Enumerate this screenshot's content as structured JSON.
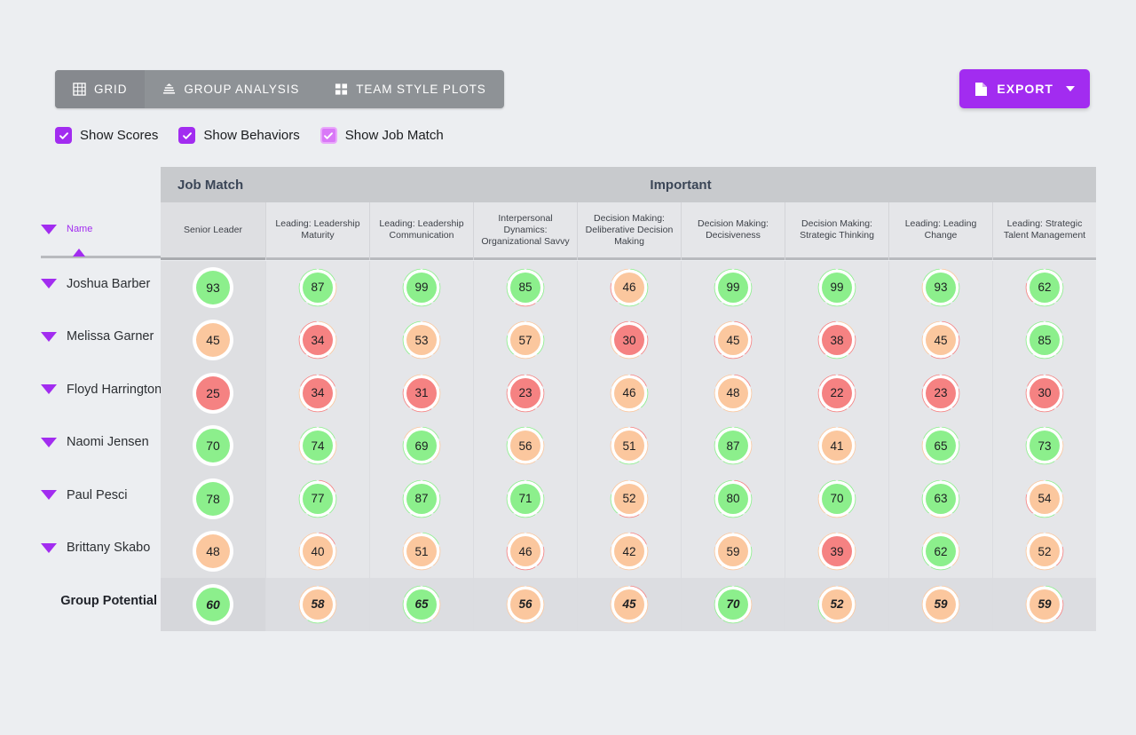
{
  "toolbar": {
    "tabs": [
      {
        "label": "GRID",
        "icon": "grid-icon",
        "active": true
      },
      {
        "label": "GROUP ANALYSIS",
        "icon": "group-analysis-icon",
        "active": false
      },
      {
        "label": "TEAM STYLE PLOTS",
        "icon": "team-style-plots-icon",
        "active": false
      }
    ],
    "export_label": "EXPORT",
    "export_icon": "document-icon",
    "export_color": "#a22cf0"
  },
  "filters": [
    {
      "label": "Show Scores",
      "checked": true,
      "style": "solid"
    },
    {
      "label": "Show Behaviors",
      "checked": true,
      "style": "solid"
    },
    {
      "label": "Show Job Match",
      "checked": true,
      "style": "light"
    }
  ],
  "grid": {
    "name_column": {
      "sort_label": "Name",
      "sort_direction": "ascending"
    },
    "bands": [
      {
        "label": "Job Match",
        "span": 1
      },
      {
        "label": "Important",
        "span": 8
      }
    ],
    "columns": [
      "Senior Leader",
      "Leading: Leadership Maturity",
      "Leading: Leadership Communication",
      "Interpersonal Dynamics: Organizational Savvy",
      "Decision Making: Deliberative Decision Making",
      "Decision Making: Decisiveness",
      "Decision Making: Strategic Thinking",
      "Leading: Leading Change",
      "Leading: Strategic Talent Management"
    ],
    "colors": {
      "green": "#8cef8c",
      "orange": "#fbc79e",
      "red": "#f58282"
    },
    "rows": [
      {
        "name": "Joshua Barber",
        "group": false,
        "cells": [
          {
            "value": 93,
            "color": "green",
            "ring": []
          },
          {
            "value": 87,
            "color": "green",
            "ring": [
              "green",
              "orange",
              "green",
              "green",
              "green"
            ]
          },
          {
            "value": 99,
            "color": "green",
            "ring": [
              "green",
              "green",
              "green",
              "green",
              "green"
            ]
          },
          {
            "value": 85,
            "color": "green",
            "ring": [
              "green",
              "green",
              "red",
              "green",
              "green"
            ]
          },
          {
            "value": 46,
            "color": "orange",
            "ring": [
              "green",
              "green",
              "green",
              "red",
              "orange"
            ]
          },
          {
            "value": 99,
            "color": "green",
            "ring": [
              "green",
              "green",
              "green",
              "green",
              "green"
            ]
          },
          {
            "value": 99,
            "color": "green",
            "ring": [
              "green",
              "green",
              "green",
              "green",
              "green"
            ]
          },
          {
            "value": 93,
            "color": "green",
            "ring": [
              "orange",
              "green",
              "green",
              "orange",
              "green"
            ]
          },
          {
            "value": 62,
            "color": "green",
            "ring": [
              "green",
              "green",
              "green",
              "red",
              "green"
            ]
          }
        ]
      },
      {
        "name": "Melissa Garner",
        "group": false,
        "cells": [
          {
            "value": 45,
            "color": "orange",
            "ring": []
          },
          {
            "value": 34,
            "color": "red",
            "ring": [
              "orange",
              "orange",
              "red",
              "red",
              "red"
            ]
          },
          {
            "value": 53,
            "color": "orange",
            "ring": [
              "orange",
              "orange",
              "orange",
              "green",
              "green"
            ]
          },
          {
            "value": 57,
            "color": "orange",
            "ring": [
              "orange",
              "green",
              "orange",
              "green",
              "orange"
            ]
          },
          {
            "value": 30,
            "color": "red",
            "ring": [
              "red",
              "red",
              "orange",
              "orange",
              "red"
            ]
          },
          {
            "value": 45,
            "color": "orange",
            "ring": [
              "red",
              "red",
              "red",
              "red",
              "orange"
            ]
          },
          {
            "value": 38,
            "color": "red",
            "ring": [
              "orange",
              "red",
              "green",
              "red",
              "red"
            ]
          },
          {
            "value": 45,
            "color": "orange",
            "ring": [
              "red",
              "red",
              "red",
              "orange",
              "orange"
            ]
          },
          {
            "value": 85,
            "color": "green",
            "ring": [
              "green",
              "green",
              "green",
              "green",
              "green"
            ]
          }
        ]
      },
      {
        "name": "Floyd Harrington",
        "group": false,
        "cells": [
          {
            "value": 25,
            "color": "red",
            "ring": []
          },
          {
            "value": 34,
            "color": "red",
            "ring": [
              "red",
              "orange",
              "red",
              "orange",
              "red"
            ]
          },
          {
            "value": 31,
            "color": "red",
            "ring": [
              "orange",
              "orange",
              "red",
              "red",
              "orange"
            ]
          },
          {
            "value": 23,
            "color": "red",
            "ring": [
              "red",
              "red",
              "red",
              "red",
              "red"
            ]
          },
          {
            "value": 46,
            "color": "orange",
            "ring": [
              "red",
              "green",
              "orange",
              "orange",
              "orange"
            ]
          },
          {
            "value": 48,
            "color": "orange",
            "ring": [
              "red",
              "orange",
              "orange",
              "orange",
              "orange"
            ]
          },
          {
            "value": 22,
            "color": "red",
            "ring": [
              "red",
              "red",
              "red",
              "red",
              "red"
            ]
          },
          {
            "value": 23,
            "color": "red",
            "ring": [
              "red",
              "red",
              "red",
              "red",
              "red"
            ]
          },
          {
            "value": 30,
            "color": "red",
            "ring": [
              "red",
              "red",
              "red",
              "red",
              "red"
            ]
          }
        ]
      },
      {
        "name": "Naomi Jensen",
        "group": false,
        "cells": [
          {
            "value": 70,
            "color": "green",
            "ring": []
          },
          {
            "value": 74,
            "color": "green",
            "ring": [
              "green",
              "orange",
              "green",
              "orange",
              "green"
            ]
          },
          {
            "value": 69,
            "color": "green",
            "ring": [
              "green",
              "orange",
              "green",
              "green",
              "orange"
            ]
          },
          {
            "value": 56,
            "color": "orange",
            "ring": [
              "green",
              "orange",
              "orange",
              "green",
              "green"
            ]
          },
          {
            "value": 51,
            "color": "orange",
            "ring": [
              "red",
              "orange",
              "green",
              "orange",
              "orange"
            ]
          },
          {
            "value": 87,
            "color": "green",
            "ring": [
              "green",
              "orange",
              "green",
              "green",
              "green"
            ]
          },
          {
            "value": 41,
            "color": "orange",
            "ring": [
              "orange",
              "orange",
              "orange",
              "orange",
              "orange"
            ]
          },
          {
            "value": 65,
            "color": "green",
            "ring": [
              "green",
              "green",
              "green",
              "orange",
              "green"
            ]
          },
          {
            "value": 73,
            "color": "green",
            "ring": [
              "green",
              "orange",
              "green",
              "green",
              "green"
            ]
          }
        ]
      },
      {
        "name": "Paul Pesci",
        "group": false,
        "cells": [
          {
            "value": 78,
            "color": "green",
            "ring": []
          },
          {
            "value": 77,
            "color": "green",
            "ring": [
              "red",
              "green",
              "green",
              "green",
              "green"
            ]
          },
          {
            "value": 87,
            "color": "green",
            "ring": [
              "green",
              "green",
              "green",
              "green",
              "green"
            ]
          },
          {
            "value": 71,
            "color": "green",
            "ring": [
              "green",
              "green",
              "green",
              "green",
              "green"
            ]
          },
          {
            "value": 52,
            "color": "orange",
            "ring": [
              "orange",
              "orange",
              "red",
              "green",
              "orange"
            ]
          },
          {
            "value": 80,
            "color": "green",
            "ring": [
              "red",
              "green",
              "green",
              "green",
              "green"
            ]
          },
          {
            "value": 70,
            "color": "green",
            "ring": [
              "green",
              "green",
              "orange",
              "orange",
              "green"
            ]
          },
          {
            "value": 63,
            "color": "green",
            "ring": [
              "green",
              "green",
              "orange",
              "green",
              "green"
            ]
          },
          {
            "value": 54,
            "color": "orange",
            "ring": [
              "green",
              "orange",
              "green",
              "red",
              "orange"
            ]
          }
        ]
      },
      {
        "name": "Brittany Skabo",
        "group": false,
        "cells": [
          {
            "value": 48,
            "color": "orange",
            "ring": []
          },
          {
            "value": 40,
            "color": "orange",
            "ring": [
              "red",
              "orange",
              "orange",
              "orange",
              "orange"
            ]
          },
          {
            "value": 51,
            "color": "orange",
            "ring": [
              "green",
              "orange",
              "orange",
              "orange",
              "orange"
            ]
          },
          {
            "value": 46,
            "color": "orange",
            "ring": [
              "orange",
              "red",
              "red",
              "red",
              "orange"
            ]
          },
          {
            "value": 42,
            "color": "orange",
            "ring": [
              "red",
              "orange",
              "orange",
              "orange",
              "orange"
            ]
          },
          {
            "value": 59,
            "color": "orange",
            "ring": [
              "orange",
              "green",
              "orange",
              "orange",
              "orange"
            ]
          },
          {
            "value": 39,
            "color": "red",
            "ring": [
              "orange",
              "orange",
              "orange",
              "orange",
              "orange"
            ]
          },
          {
            "value": 62,
            "color": "green",
            "ring": [
              "orange",
              "orange",
              "green",
              "green",
              "orange"
            ]
          },
          {
            "value": 52,
            "color": "orange",
            "ring": [
              "orange",
              "red",
              "orange",
              "orange",
              "orange"
            ]
          }
        ]
      },
      {
        "name": "Group Potential",
        "group": true,
        "cells": [
          {
            "value": 60,
            "color": "green",
            "ring": []
          },
          {
            "value": 58,
            "color": "orange",
            "ring": [
              "orange",
              "orange",
              "green",
              "orange",
              "orange"
            ]
          },
          {
            "value": 65,
            "color": "green",
            "ring": [
              "green",
              "orange",
              "green",
              "green",
              "green"
            ]
          },
          {
            "value": 56,
            "color": "orange",
            "ring": [
              "orange",
              "orange",
              "orange",
              "orange",
              "orange"
            ]
          },
          {
            "value": 45,
            "color": "orange",
            "ring": [
              "red",
              "orange",
              "orange",
              "orange",
              "orange"
            ]
          },
          {
            "value": 70,
            "color": "green",
            "ring": [
              "green",
              "orange",
              "green",
              "green",
              "green"
            ]
          },
          {
            "value": 52,
            "color": "orange",
            "ring": [
              "orange",
              "orange",
              "orange",
              "green",
              "orange"
            ]
          },
          {
            "value": 59,
            "color": "orange",
            "ring": [
              "orange",
              "orange",
              "orange",
              "orange",
              "orange"
            ]
          },
          {
            "value": 59,
            "color": "orange",
            "ring": [
              "green",
              "red",
              "orange",
              "orange",
              "orange"
            ]
          }
        ]
      }
    ]
  }
}
